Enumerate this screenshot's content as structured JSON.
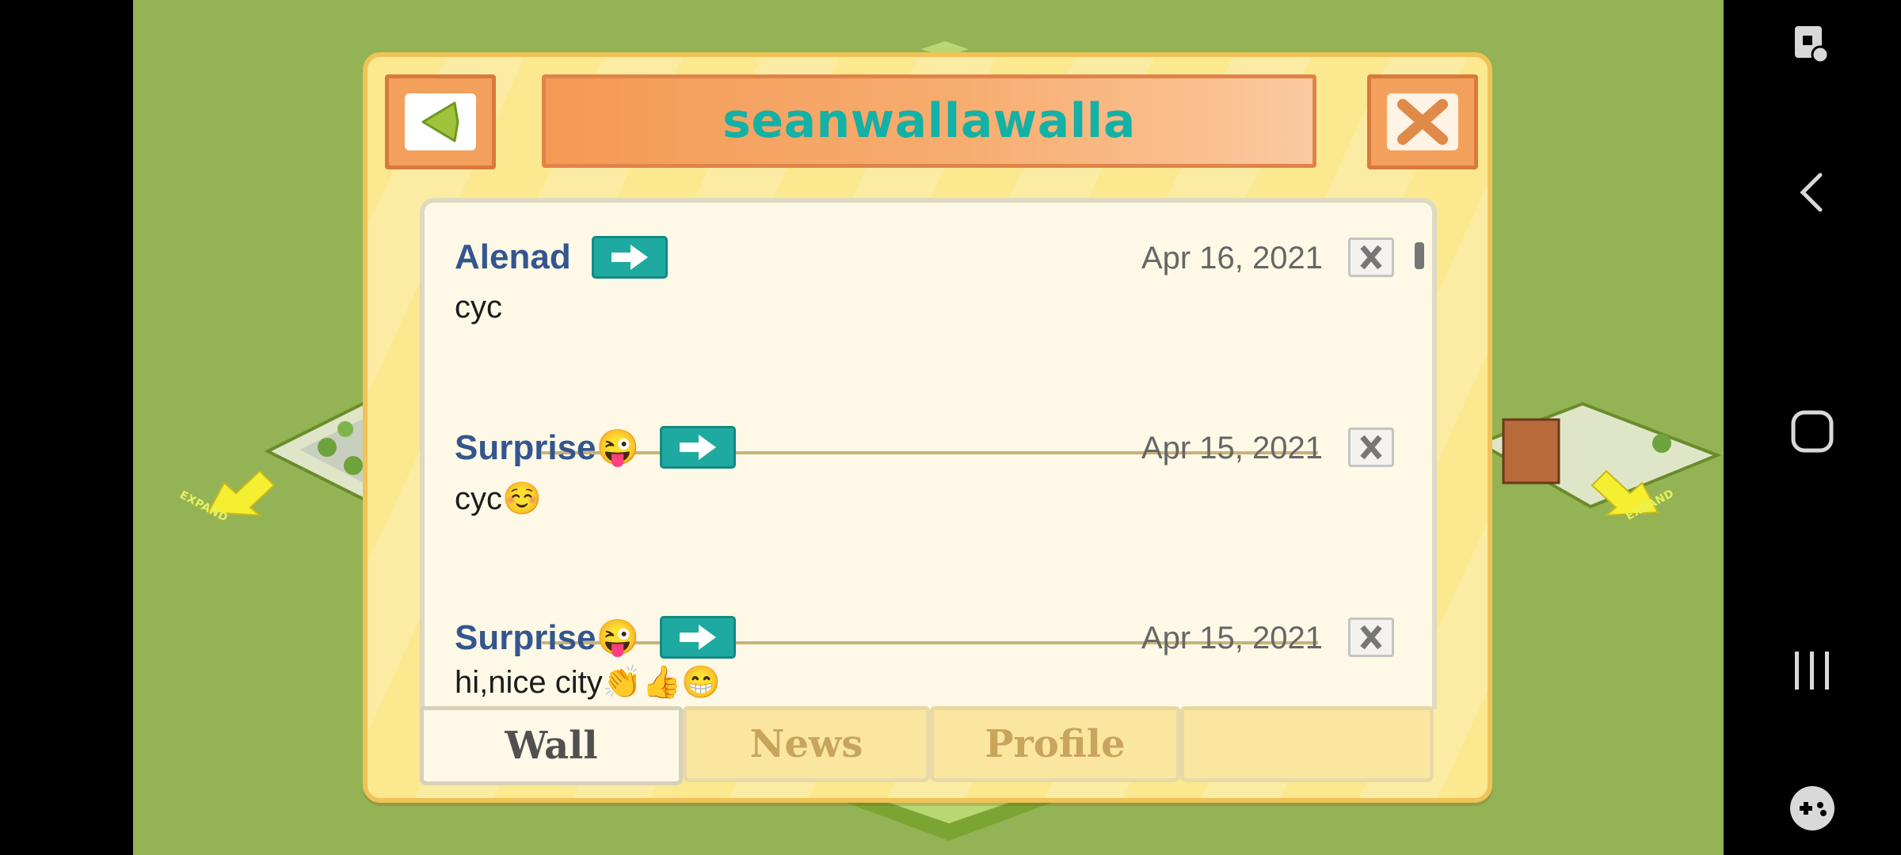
{
  "game": {
    "expand_left_label": "EXPAND",
    "expand_right_label": "EXPAND",
    "colors": {
      "grass": "#94b354",
      "dialog": "#fbe88f",
      "title_text": "#14b1a6",
      "author": "#33568f"
    }
  },
  "dialog": {
    "title": "seanwallawalla",
    "back_icon": "back-arrow-icon",
    "close_icon": "close-x-icon"
  },
  "posts": [
    {
      "author": "Alenad",
      "date": "Apr 16, 2021",
      "message": "cyc"
    },
    {
      "author": "Surprise😜",
      "date": "Apr 15, 2021",
      "message": "cyc☺️"
    },
    {
      "author": "Surprise😜",
      "date": "Apr 15, 2021",
      "message": "hi,nice city👏👍😁"
    }
  ],
  "tabs": [
    {
      "label": "Wall",
      "active": true
    },
    {
      "label": "News",
      "active": false
    },
    {
      "label": "Profile",
      "active": false
    },
    {
      "label": "",
      "active": false
    }
  ],
  "navbar": {
    "icons": [
      "screen-lock-icon",
      "back-icon",
      "home-icon",
      "recent-apps-icon",
      "game-controller-icon"
    ]
  }
}
